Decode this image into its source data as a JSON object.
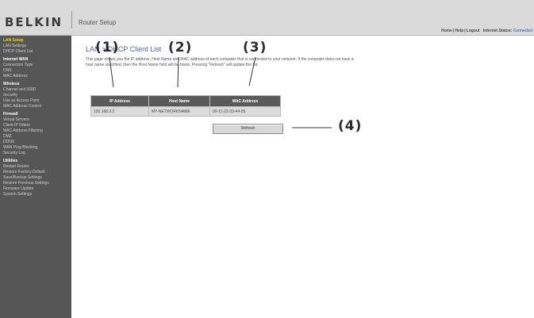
{
  "header": {
    "brand": "BELKIN",
    "app_title": "Router Setup",
    "links": {
      "home": "Home",
      "help": "Help",
      "logout": "Logout",
      "status_label": "Internet Status:",
      "status_value": "Connected"
    }
  },
  "sidebar": {
    "sections": [
      {
        "title": "LAN Setup",
        "items": [
          "LAN Settings",
          "DHCP Client List"
        ]
      },
      {
        "title": "Internet WAN",
        "items": [
          "Connection Type",
          "DNS",
          "MAC Address"
        ]
      },
      {
        "title": "Wireless",
        "items": [
          "Channel and SSID",
          "Security",
          "Use as Access Point",
          "MAC Address Control"
        ]
      },
      {
        "title": "Firewall",
        "items": [
          "Virtual Servers",
          "Client IP Filters",
          "MAC Address Filtering",
          "DMZ",
          "DDNS",
          "WAN Ping Blocking",
          "Security Log"
        ]
      },
      {
        "title": "Utilities",
        "items": [
          "Restart Router",
          "Restore Factory Default",
          "Save/Backup Settings",
          "Restore Previous Settings",
          "Firmware Update",
          "System Settings"
        ]
      }
    ]
  },
  "main": {
    "title": "LAN > DHCP Client List",
    "description": "This page shows you the IP address, Host Name and MAC address of each computer that is connected to your network. If the computer does not have a host name specified, then the Host Name field will be blank. Pressing \"Refresh\" will update the list.",
    "table": {
      "headers": [
        "IP Address",
        "Host Name",
        "MAC Address"
      ],
      "rows": [
        [
          "192.168.2.2",
          "MY-NETWORKNAME",
          "00-11-22-33-44-55"
        ]
      ]
    },
    "refresh_label": "Refresh"
  },
  "callouts": [
    "(1)",
    "(2)",
    "(3)",
    "(4)"
  ]
}
